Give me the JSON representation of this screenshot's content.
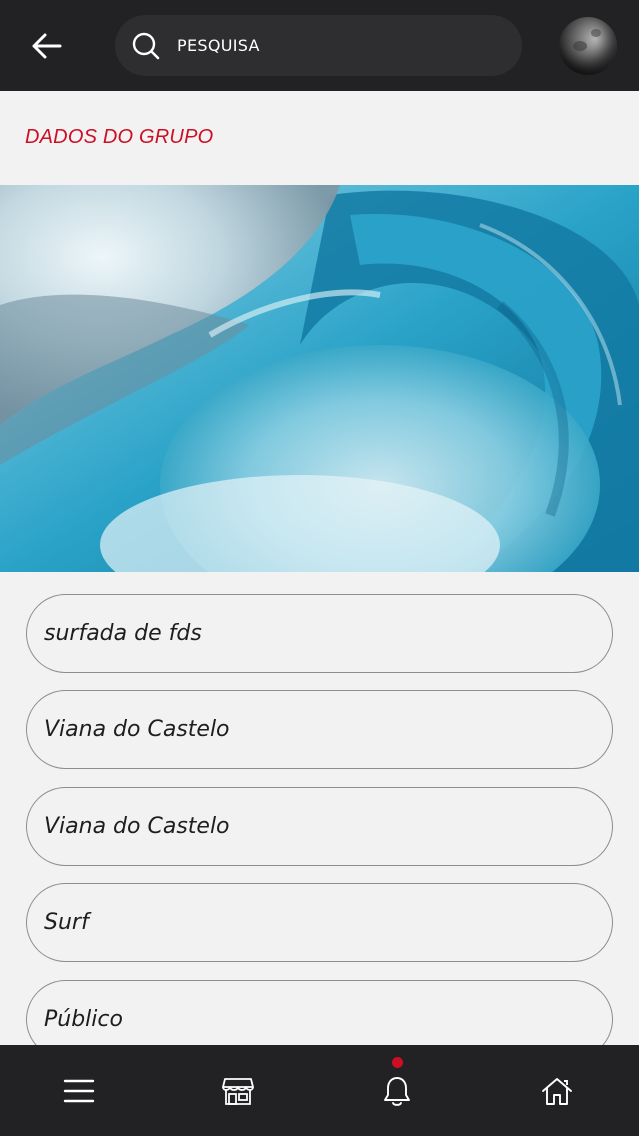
{
  "header": {
    "search_placeholder": "PESQUISA",
    "back_icon": "arrow-left-icon",
    "search_icon": "search-icon"
  },
  "section": {
    "title": "DADOS DO GRUPO"
  },
  "fields": [
    {
      "value": "surfada de fds"
    },
    {
      "value": "Viana do Castelo"
    },
    {
      "value": "Viana do Castelo"
    },
    {
      "value": "Surf"
    },
    {
      "value": "Público"
    }
  ],
  "bottom_nav": {
    "items": [
      {
        "icon": "menu-icon"
      },
      {
        "icon": "store-icon"
      },
      {
        "icon": "bell-icon",
        "has_notification": true
      },
      {
        "icon": "home-icon"
      }
    ]
  },
  "colors": {
    "accent": "#cc0f24",
    "bar_background": "#222224",
    "page_background": "#f2f2f2"
  }
}
